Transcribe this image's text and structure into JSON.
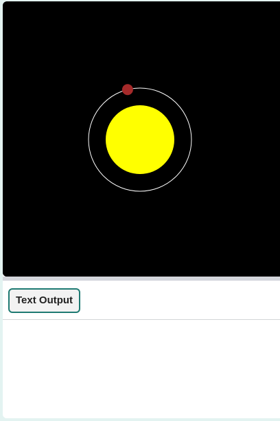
{
  "scene": {
    "background_color": "#000000",
    "sun": {
      "name": "sun",
      "color": "#ffff00"
    },
    "orbit": {
      "color": "#ffffff"
    },
    "planet": {
      "name": "planet",
      "color": "#a52a2a",
      "orbit_angle_deg": 104
    }
  },
  "output_panel": {
    "tab_label": "Text Output",
    "tab_border_color": "#1e7a72",
    "text": ""
  }
}
